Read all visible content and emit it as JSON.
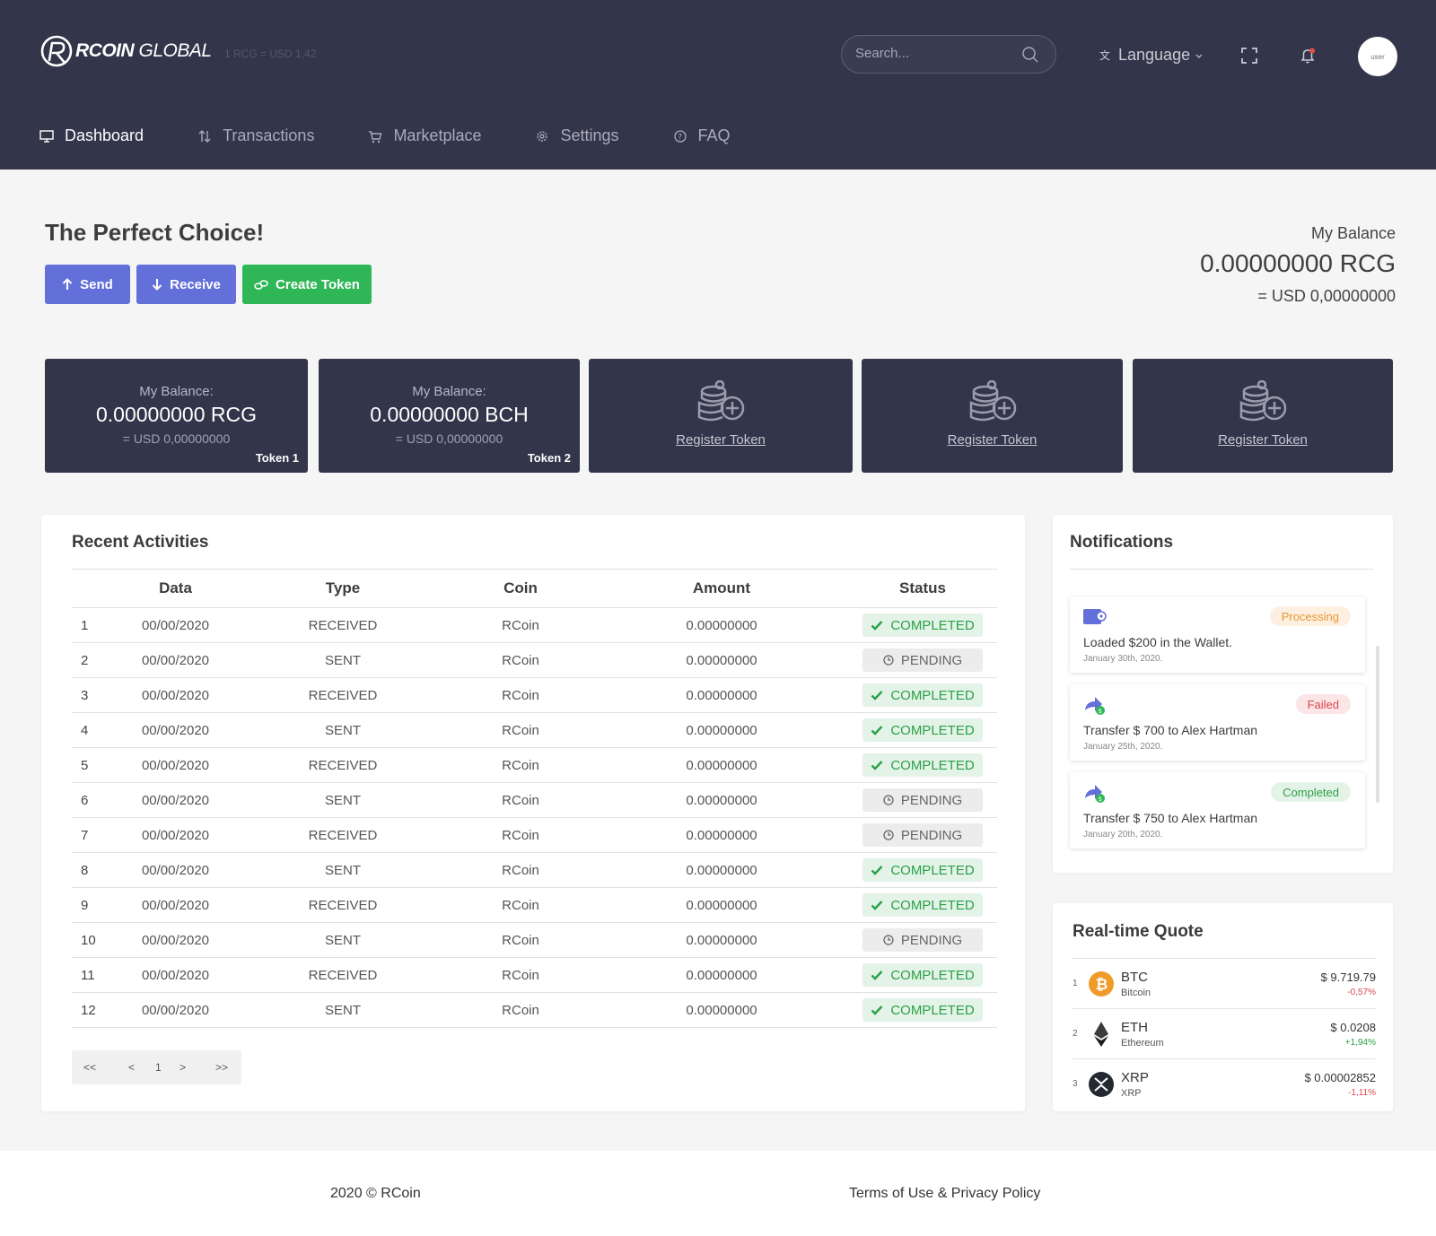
{
  "brand": {
    "name_bold": "RCOIN",
    "name_light": " GLOBAL",
    "rate": "1 RCG = USD 1,42"
  },
  "header": {
    "search_placeholder": "Search...",
    "language_label": "Language",
    "avatar_label": "user"
  },
  "nav": [
    {
      "label": "Dashboard",
      "icon": "monitor-icon",
      "active": true
    },
    {
      "label": "Transactions",
      "icon": "arrows-updown-icon"
    },
    {
      "label": "Marketplace",
      "icon": "cart-icon"
    },
    {
      "label": "Settings",
      "icon": "gear-icon"
    },
    {
      "label": "FAQ",
      "icon": "question-icon"
    }
  ],
  "page": {
    "title": "The Perfect Choice!",
    "buttons": {
      "send": "Send",
      "receive": "Receive",
      "create_token": "Create Token"
    },
    "balance": {
      "label": "My Balance",
      "value": "0.00000000 RCG",
      "usd": "= USD 0,00000000"
    }
  },
  "tokens": [
    {
      "label": "My Balance:",
      "value": "0.00000000 RCG",
      "usd": "= USD 0,00000000",
      "name": "Token 1"
    },
    {
      "label": "My Balance:",
      "value": "0.00000000 BCH",
      "usd": "= USD 0,00000000",
      "name": "Token 2"
    }
  ],
  "register_label": "Register Token",
  "activities": {
    "title": "Recent Activities",
    "columns": [
      "Data",
      "Type",
      "Coin",
      "Amount",
      "Status"
    ],
    "rows": [
      {
        "n": "1",
        "date": "00/00/2020",
        "type": "RECEIVED",
        "coin": "RCoin",
        "amount": "0.00000000",
        "status": "COMPLETED"
      },
      {
        "n": "2",
        "date": "00/00/2020",
        "type": "SENT",
        "coin": "RCoin",
        "amount": "0.00000000",
        "status": "PENDING"
      },
      {
        "n": "3",
        "date": "00/00/2020",
        "type": "RECEIVED",
        "coin": "RCoin",
        "amount": "0.00000000",
        "status": "COMPLETED"
      },
      {
        "n": "4",
        "date": "00/00/2020",
        "type": "SENT",
        "coin": "RCoin",
        "amount": "0.00000000",
        "status": "COMPLETED"
      },
      {
        "n": "5",
        "date": "00/00/2020",
        "type": "RECEIVED",
        "coin": "RCoin",
        "amount": "0.00000000",
        "status": "COMPLETED"
      },
      {
        "n": "6",
        "date": "00/00/2020",
        "type": "SENT",
        "coin": "RCoin",
        "amount": "0.00000000",
        "status": "PENDING"
      },
      {
        "n": "7",
        "date": "00/00/2020",
        "type": "RECEIVED",
        "coin": "RCoin",
        "amount": "0.00000000",
        "status": "PENDING"
      },
      {
        "n": "8",
        "date": "00/00/2020",
        "type": "SENT",
        "coin": "RCoin",
        "amount": "0.00000000",
        "status": "COMPLETED"
      },
      {
        "n": "9",
        "date": "00/00/2020",
        "type": "RECEIVED",
        "coin": "RCoin",
        "amount": "0.00000000",
        "status": "COMPLETED"
      },
      {
        "n": "10",
        "date": "00/00/2020",
        "type": "SENT",
        "coin": "RCoin",
        "amount": "0.00000000",
        "status": "PENDING"
      },
      {
        "n": "11",
        "date": "00/00/2020",
        "type": "RECEIVED",
        "coin": "RCoin",
        "amount": "0.00000000",
        "status": "COMPLETED"
      },
      {
        "n": "12",
        "date": "00/00/2020",
        "type": "SENT",
        "coin": "RCoin",
        "amount": "0.00000000",
        "status": "COMPLETED"
      }
    ],
    "pager": {
      "first": "<<",
      "prev": "<",
      "page": "1",
      "next": ">",
      "last": ">>"
    }
  },
  "notifications": {
    "title": "Notifications",
    "items": [
      {
        "icon": "wallet-icon",
        "badge": "Processing",
        "text": "Loaded $200 in the Wallet.",
        "date": "January 30th, 2020."
      },
      {
        "icon": "transfer-icon",
        "badge": "Failed",
        "text": "Transfer $ 700 to Alex Hartman",
        "date": "January 25th, 2020."
      },
      {
        "icon": "transfer-icon",
        "badge": "Completed",
        "text": "Transfer $ 750 to Alex Hartman",
        "date": "January 20th, 2020."
      }
    ]
  },
  "quotes": {
    "title": "Real-time Quote",
    "items": [
      {
        "n": "1",
        "symbol": "BTC",
        "name": "Bitcoin",
        "price": "$ 9.719.79",
        "change": "-0,57%",
        "icon": "bitcoin-icon"
      },
      {
        "n": "2",
        "symbol": "ETH",
        "name": "Ethereum",
        "price": "$ 0.0208",
        "change": "+1,94%",
        "icon": "ethereum-icon"
      },
      {
        "n": "3",
        "symbol": "XRP",
        "name": "XRP",
        "price": "$ 0.00002852",
        "change": "-1,11%",
        "icon": "xrp-icon"
      }
    ]
  },
  "footer": {
    "copyright": "2020 © RCoin",
    "legal": "Terms of Use & Privacy Policy"
  },
  "colors": {
    "header": "#33354a",
    "primary": "#6470d9",
    "success": "#2fb656",
    "danger": "#d34145"
  }
}
